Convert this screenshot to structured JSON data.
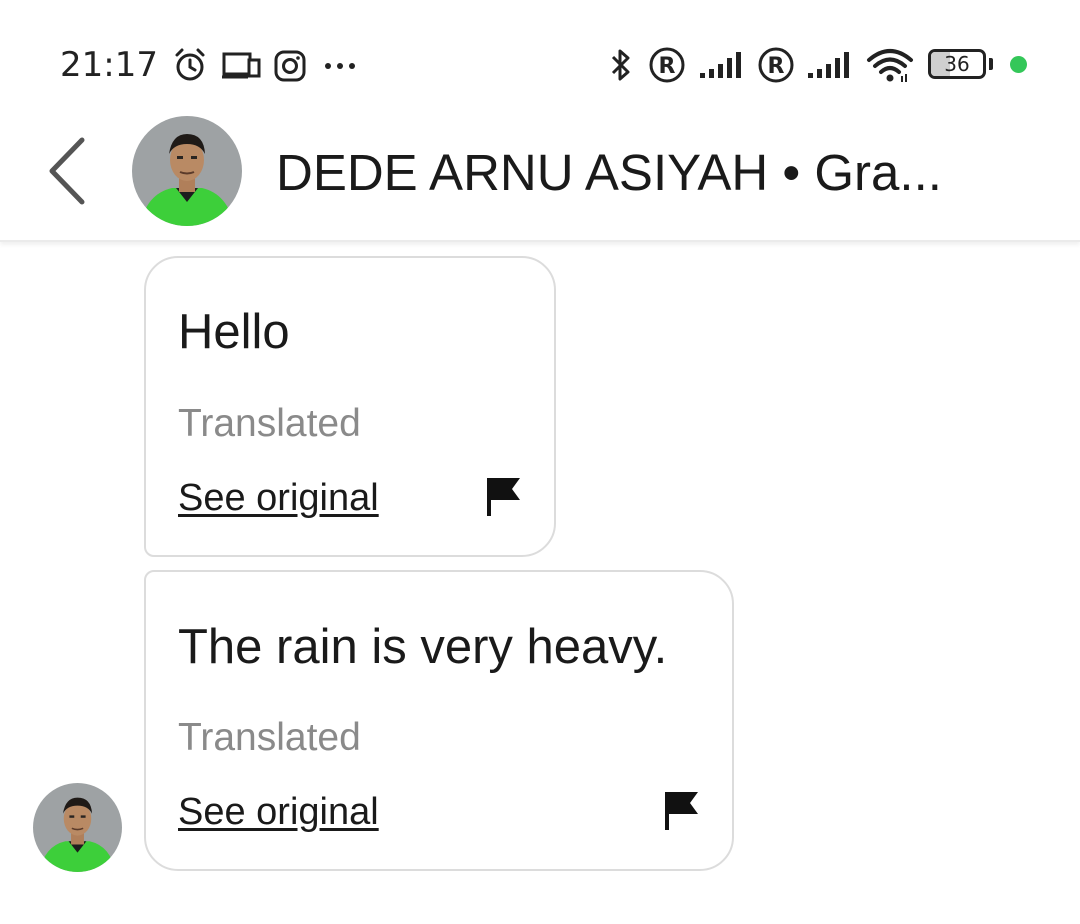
{
  "status_bar": {
    "time": "21:17",
    "left_icons": [
      "alarm-icon",
      "cast-screen-icon",
      "instagram-icon",
      "more-dots-icon"
    ],
    "right_icons": [
      "bluetooth-icon",
      "roaming-r-icon",
      "signal-icon",
      "roaming-r-icon",
      "signal-icon",
      "wifi-icon"
    ],
    "battery_level": "36",
    "charge_dot_color": "#34c759"
  },
  "header": {
    "back_icon": "chevron-left-icon",
    "title": "DEDE ARNU ASIYAH • Gra..."
  },
  "messages": [
    {
      "text": "Hello",
      "status": "Translated",
      "see_original": "See original",
      "flag_icon": "flag-icon"
    },
    {
      "text": "The rain is very heavy.",
      "status": "Translated",
      "see_original": "See original",
      "flag_icon": "flag-icon"
    }
  ],
  "colors": {
    "avatar_shirt": "#3dcf3a",
    "avatar_bg": "#9ea2a4",
    "bubble_border": "#dcdcdc",
    "muted_text": "#8a8a8a"
  }
}
